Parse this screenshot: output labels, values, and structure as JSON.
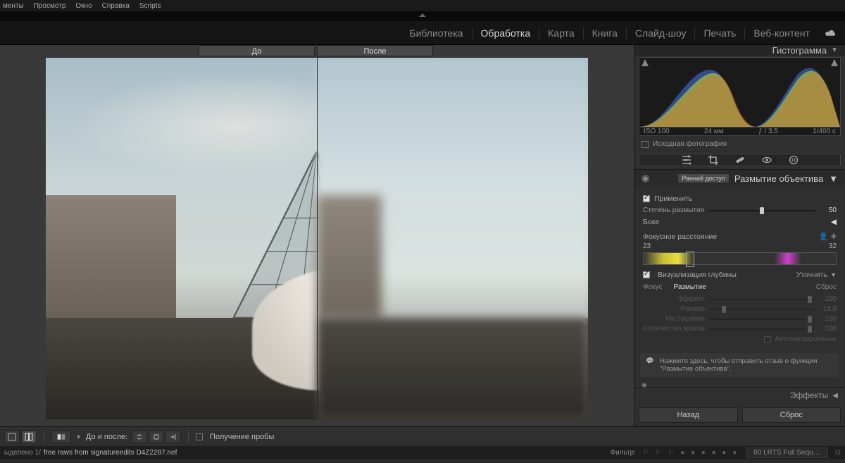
{
  "menu": {
    "items": [
      "менты",
      "Просмотр",
      "Окно",
      "Справка",
      "Scripts"
    ]
  },
  "modules": {
    "items": [
      "Библиотека",
      "Обработка",
      "Карта",
      "Книга",
      "Слайд-шоу",
      "Печать",
      "Веб-контент"
    ],
    "active": "Обработка"
  },
  "compare": {
    "before": "До",
    "after": "После"
  },
  "histogram": {
    "title": "Гистограмма",
    "iso": "ISO 100",
    "focal": "24 мм",
    "aperture": "ƒ / 3.5",
    "shutter": "1/400 с",
    "original_check": "Исходная фотография"
  },
  "lensblur": {
    "badge": "Ранний доступ",
    "title": "Размытие объектива",
    "apply": "Применить",
    "amount_label": "Степень размытия",
    "amount_value": "50",
    "bokeh_label": "Боке",
    "focal_dist_label": "Фокусное расстояние",
    "focal_dist_min": "23",
    "focal_dist_max": "32",
    "depth_vis": "Визуализация глубины",
    "refine": "Уточнить",
    "focus": "Фокус",
    "blur": "Размытие",
    "reset_small": "Сброс",
    "params": {
      "effect": {
        "label": "Эффект",
        "value": "100"
      },
      "size": {
        "label": "Размер",
        "value": "15,0"
      },
      "feather": {
        "label": "Растушевка",
        "value": "100"
      },
      "paint": {
        "label": "Количество краски",
        "value": "100"
      }
    },
    "automask": "Автомаскирование",
    "feedback": "Нажмите здесь, чтобы отправить отзыв о функции \"Размытие объектива\"."
  },
  "effects_panel": "Эффекты",
  "buttons": {
    "back": "Назад",
    "reset": "Сброс"
  },
  "toolbar": {
    "before_after_label": "До и после:",
    "soft_proof": "Получение пробы"
  },
  "status": {
    "selected": "ыделено 1/",
    "filename": "free raws from signatureedits D4Z2287.nef",
    "filter_label": "Фильтр:",
    "preset": "00 LRTS Full Sequ…"
  }
}
